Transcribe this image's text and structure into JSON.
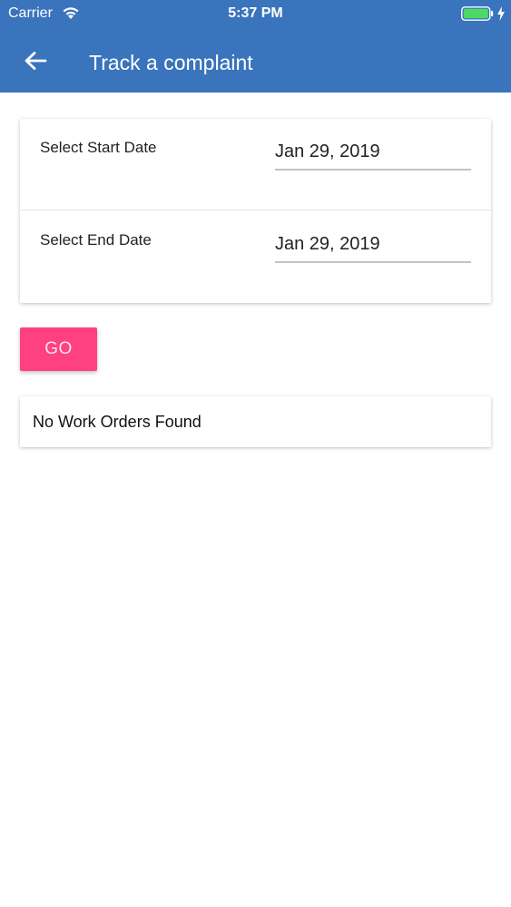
{
  "status_bar": {
    "carrier": "Carrier",
    "time": "5:37 PM",
    "wifi_icon": "wifi-icon",
    "battery_icon": "battery-full-icon",
    "charge_icon": "charging-bolt-icon"
  },
  "header": {
    "back_icon": "arrow-left-icon",
    "title": "Track a complaint",
    "color": "#3a74bc"
  },
  "date_filter": {
    "start": {
      "label": "Select Start Date",
      "value": "Jan 29, 2019"
    },
    "end": {
      "label": "Select End Date",
      "value": "Jan 29, 2019"
    }
  },
  "go_button": {
    "label": "GO",
    "color": "#ff4081"
  },
  "results": {
    "message": "No Work Orders Found"
  }
}
